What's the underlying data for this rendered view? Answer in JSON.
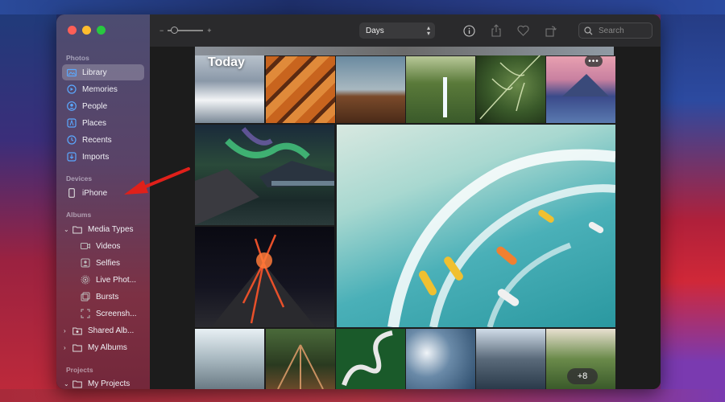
{
  "window": {
    "toolbar": {
      "zoom_minus": "−",
      "zoom_plus": "+",
      "view_select": "Days",
      "search_placeholder": "Search"
    },
    "sidebar": {
      "photos_title": "Photos",
      "photos_items": [
        {
          "label": "Library",
          "icon": "photo-library-icon",
          "selected": true
        },
        {
          "label": "Memories",
          "icon": "memories-icon"
        },
        {
          "label": "People",
          "icon": "person-icon"
        },
        {
          "label": "Places",
          "icon": "map-pin-icon"
        },
        {
          "label": "Recents",
          "icon": "clock-icon"
        },
        {
          "label": "Imports",
          "icon": "import-icon"
        }
      ],
      "devices_title": "Devices",
      "devices_items": [
        {
          "label": "iPhone",
          "icon": "iphone-icon"
        }
      ],
      "albums_title": "Albums",
      "albums_items": [
        {
          "label": "Media Types",
          "icon": "folder-icon",
          "chevron": "v"
        },
        {
          "label": "Videos",
          "icon": "video-icon"
        },
        {
          "label": "Selfies",
          "icon": "selfie-icon"
        },
        {
          "label": "Live Phot...",
          "icon": "live-photo-icon"
        },
        {
          "label": "Bursts",
          "icon": "bursts-icon"
        },
        {
          "label": "Screensh...",
          "icon": "screenshot-icon"
        },
        {
          "label": "Shared Alb...",
          "icon": "shared-album-icon",
          "chevron": ">"
        },
        {
          "label": "My Albums",
          "icon": "folder-icon",
          "chevron": ">"
        }
      ],
      "projects_title": "Projects",
      "projects_items": [
        {
          "label": "My Projects",
          "icon": "folder-icon",
          "chevron": "v"
        }
      ]
    },
    "content": {
      "section_title": "Today",
      "more_label": "•••",
      "extra_count": "+8"
    }
  }
}
